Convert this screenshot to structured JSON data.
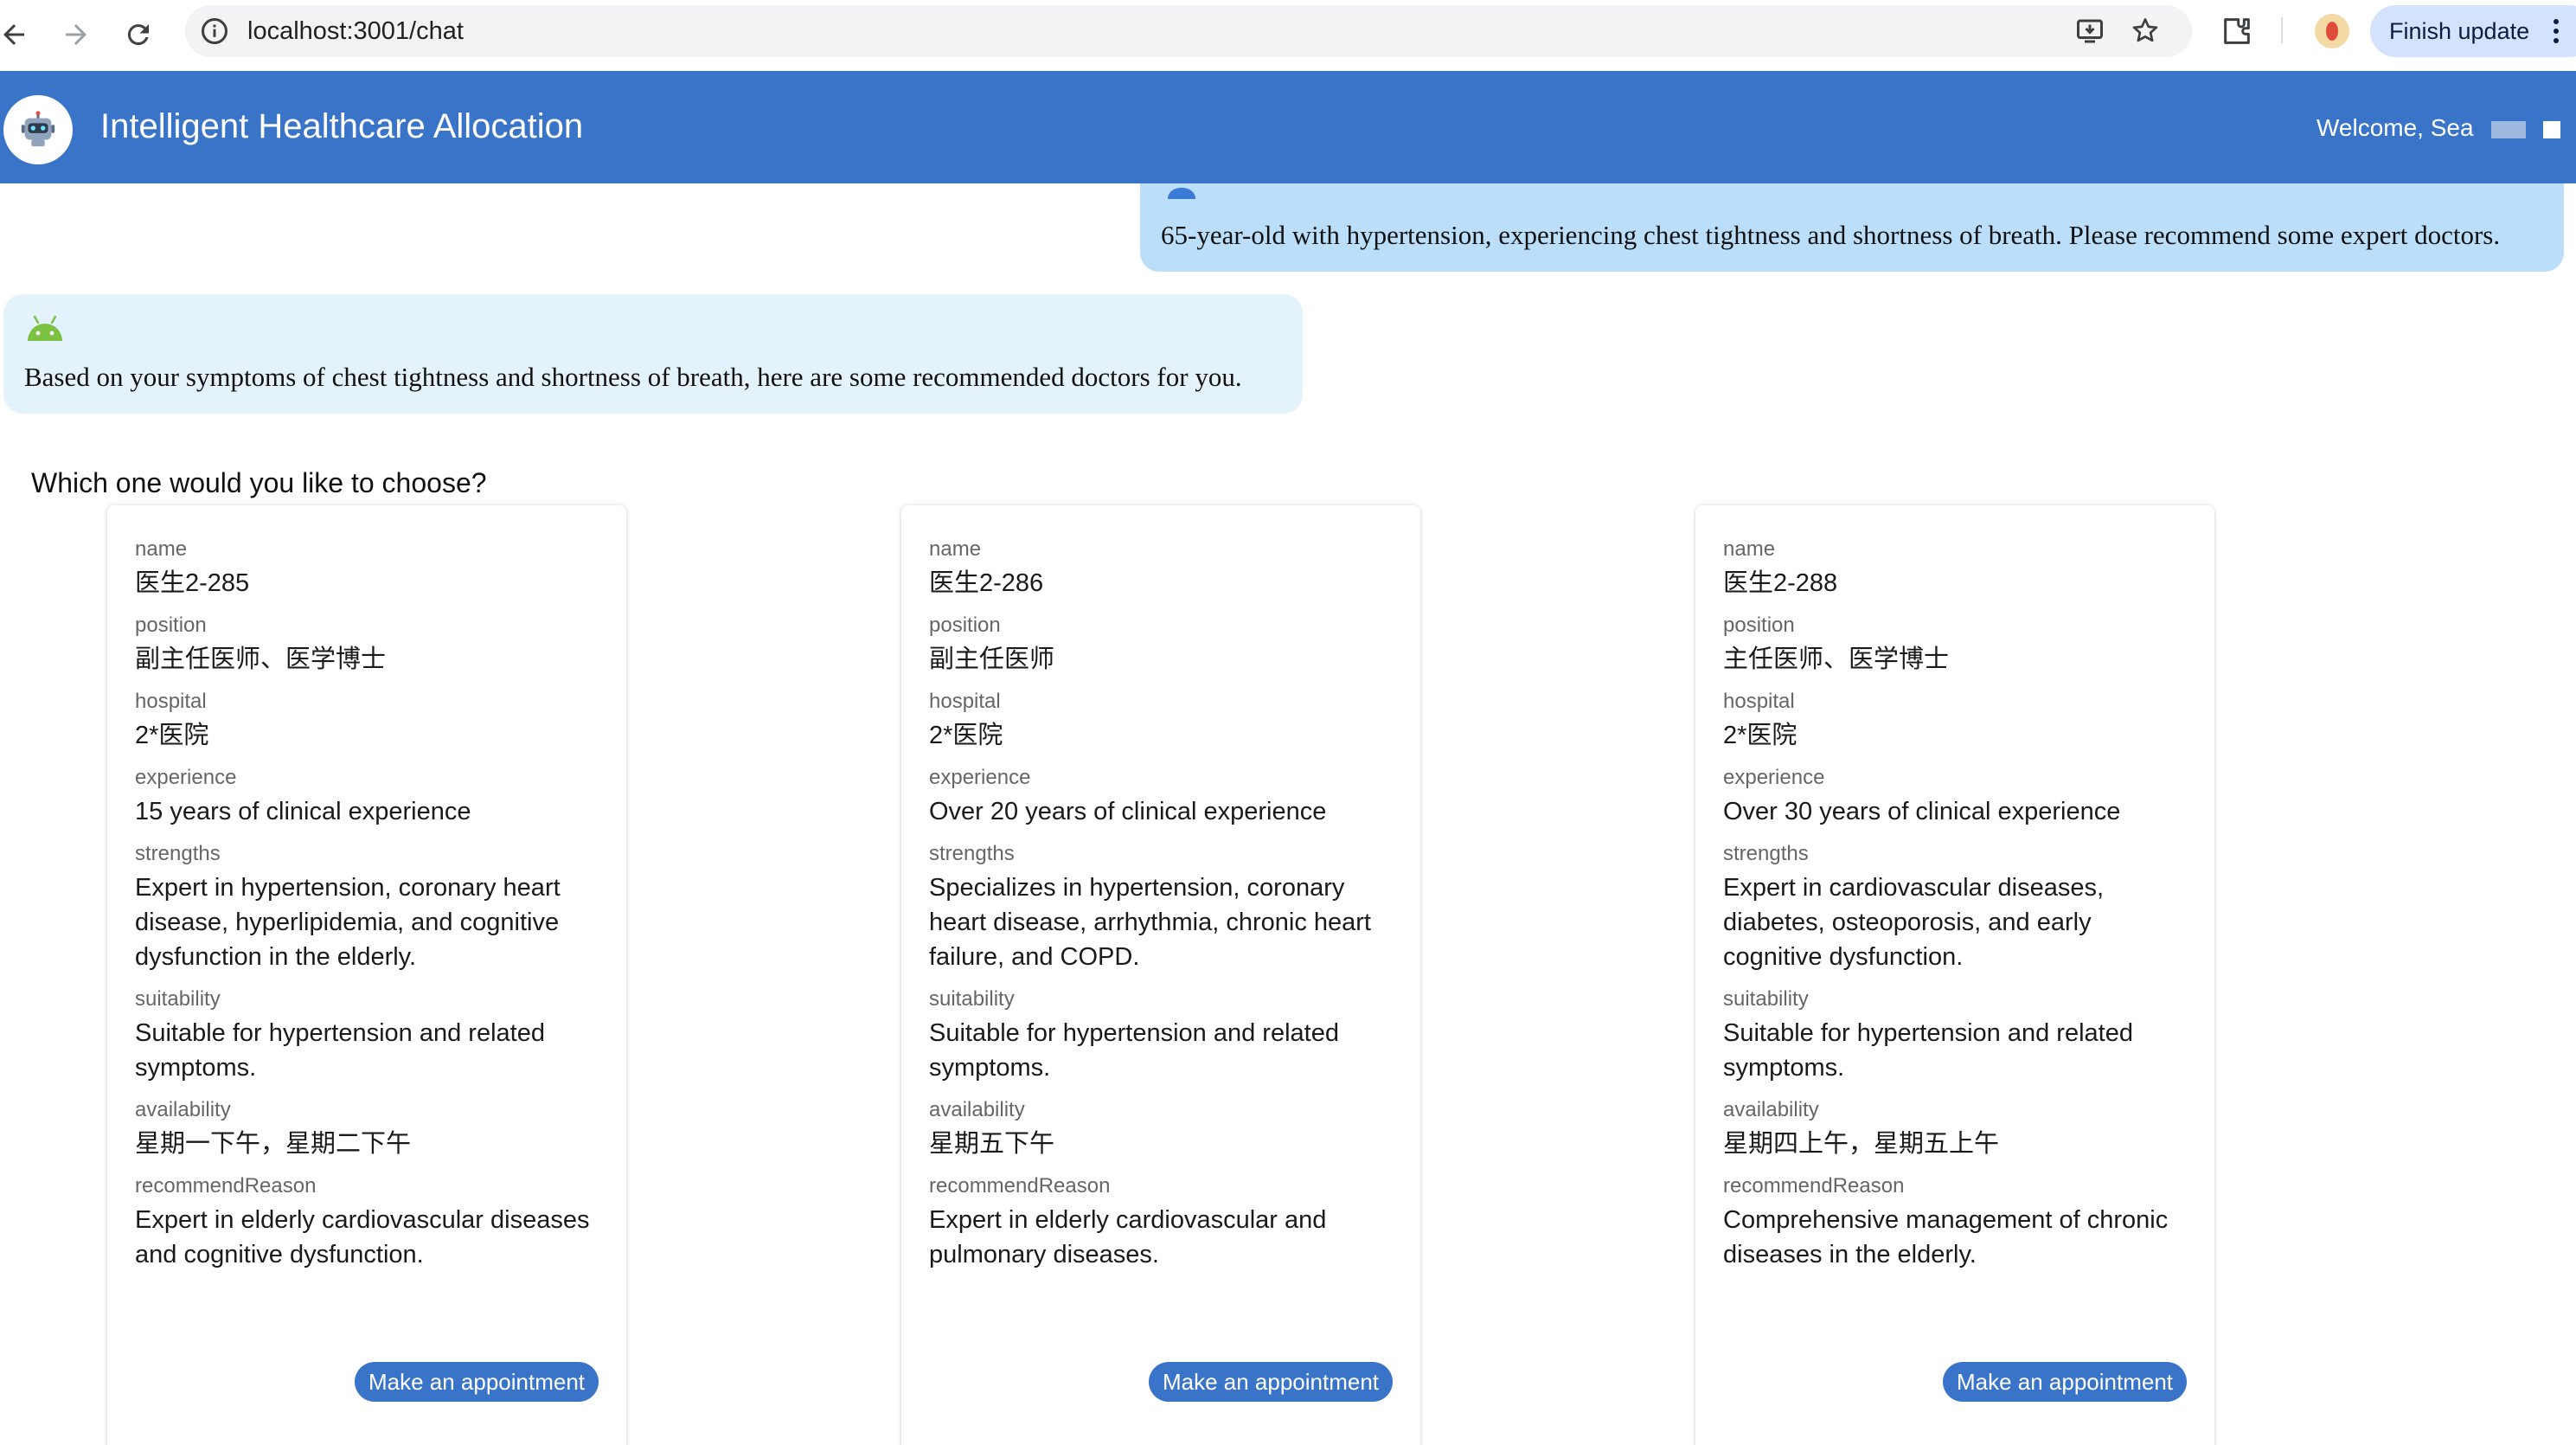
{
  "browser": {
    "url": "localhost:3001/chat",
    "finish_update_label": "Finish update",
    "icons": [
      "back-arrow-icon",
      "forward-arrow-icon",
      "reload-icon",
      "site-info-icon",
      "install-app-icon",
      "bookmark-star-icon",
      "extensions-icon",
      "profile-icon",
      "more-menu-icon"
    ]
  },
  "app": {
    "title": "Intelligent Healthcare Allocation",
    "welcome": "Welcome, Sea",
    "logo_icon": "robot-icon",
    "accent_color": "#3a74c9"
  },
  "chat": {
    "user_message": "65-year-old with hypertension, experiencing chest tightness and shortness of breath. Please recommend some expert doctors.",
    "bot_message": "Based on your symptoms of chest tightness and shortness of breath, here are some recommended doctors for you.",
    "prompt": "Which one would you like to choose?"
  },
  "labels": {
    "name": "name",
    "position": "position",
    "hospital": "hospital",
    "experience": "experience",
    "strengths": "strengths",
    "suitability": "suitability",
    "availability": "availability",
    "recommendReason": "recommendReason",
    "appointment_button": "Make an appointment"
  },
  "doctors": [
    {
      "name": "医生2-285",
      "position": "副主任医师、医学博士",
      "hospital": "2*医院",
      "experience": "15 years of clinical experience",
      "strengths": "Expert in hypertension, coronary heart disease, hyperlipidemia, and cognitive dysfunction in the elderly.",
      "suitability": "Suitable for hypertension and related symptoms.",
      "availability": "星期一下午，星期二下午",
      "recommendReason": "Expert in elderly cardiovascular diseases and cognitive dysfunction."
    },
    {
      "name": "医生2-286",
      "position": "副主任医师",
      "hospital": "2*医院",
      "experience": "Over 20 years of clinical experience",
      "strengths": "Specializes in hypertension, coronary heart disease, arrhythmia, chronic heart failure, and COPD.",
      "suitability": "Suitable for hypertension and related symptoms.",
      "availability": "星期五下午",
      "recommendReason": "Expert in elderly cardiovascular and pulmonary diseases."
    },
    {
      "name": "医生2-288",
      "position": "主任医师、医学博士",
      "hospital": "2*医院",
      "experience": "Over 30 years of clinical experience",
      "strengths": "Expert in cardiovascular diseases, diabetes, osteoporosis, and early cognitive dysfunction.",
      "suitability": "Suitable for hypertension and related symptoms.",
      "availability": "星期四上午，星期五上午",
      "recommendReason": "Comprehensive management of chronic diseases in the elderly."
    }
  ]
}
